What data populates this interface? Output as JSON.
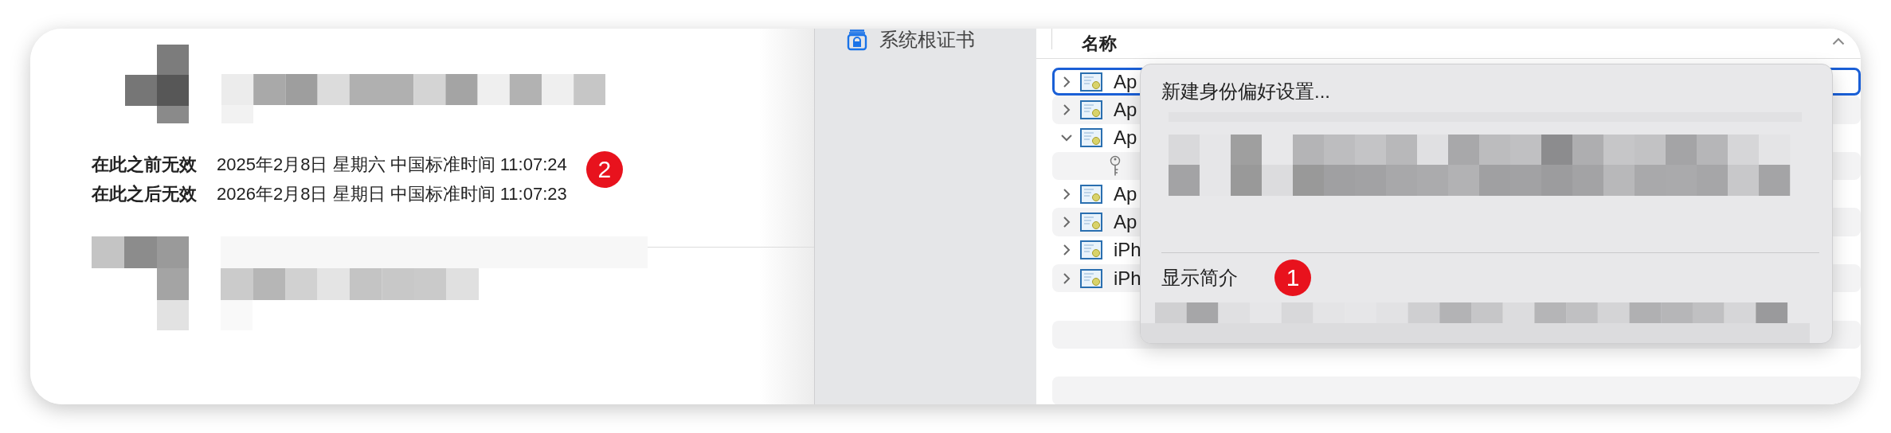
{
  "certificate_details": {
    "fields": [
      {
        "label": "在此之前无效",
        "value": "2025年2月8日 星期六 中国标准时间 11:07:24",
        "badge": "2"
      },
      {
        "label": "在此之后无效",
        "value": "2026年2月8日 星期日 中国标准时间 11:07:23"
      }
    ]
  },
  "sidebar": {
    "items": [
      {
        "label": "系统根证书"
      }
    ]
  },
  "table": {
    "columns": [
      {
        "label": "名称"
      }
    ],
    "rows": [
      {
        "kind": "certificate",
        "name": "Ap",
        "expanded": false,
        "selected": true
      },
      {
        "kind": "certificate",
        "name": "Ap",
        "expanded": false,
        "selected": false
      },
      {
        "kind": "certificate",
        "name": "Ap",
        "expanded": true,
        "selected": false,
        "children": [
          {
            "kind": "key",
            "selected": false
          }
        ]
      },
      {
        "kind": "certificate",
        "name": "Ap",
        "expanded": false,
        "selected": false
      },
      {
        "kind": "certificate",
        "name": "Ap",
        "expanded": false,
        "selected": false
      },
      {
        "kind": "certificate",
        "name": "iPh",
        "expanded": false,
        "selected": false
      },
      {
        "kind": "certificate",
        "name": "iPh",
        "expanded": false,
        "selected": false
      }
    ]
  },
  "context_menu": {
    "items": [
      {
        "kind": "item",
        "label": "新建身份偏好设置..."
      },
      {
        "kind": "redacted"
      },
      {
        "kind": "separator"
      },
      {
        "kind": "item",
        "label": "显示简介",
        "badge": "1"
      },
      {
        "kind": "redacted_bottom"
      }
    ]
  }
}
